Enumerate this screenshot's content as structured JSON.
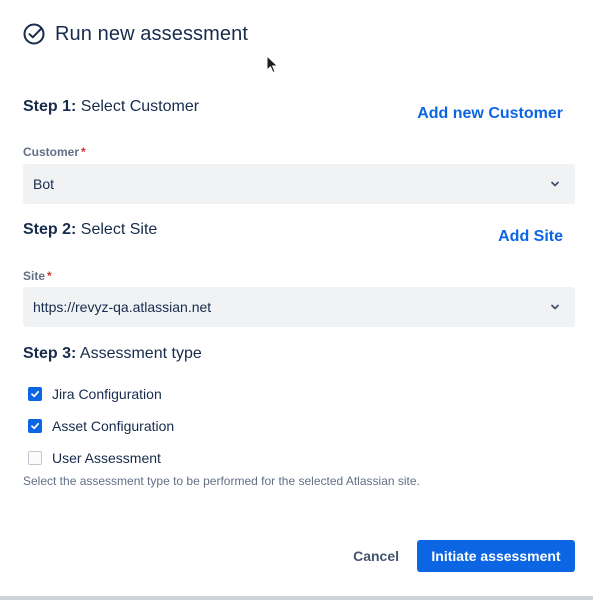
{
  "dialog": {
    "title": "Run new assessment",
    "title_icon": "check-circle-icon"
  },
  "step1": {
    "number": "Step 1:",
    "text": "Select Customer",
    "link": "Add new Customer",
    "field_label": "Customer",
    "required_mark": "*",
    "selected_value": "Bot",
    "dropdown_icon": "chevron-down-icon"
  },
  "step2": {
    "number": "Step 2:",
    "text": "Select Site",
    "link": "Add Site",
    "field_label": "Site",
    "required_mark": "*",
    "selected_value": "https://revyz-qa.atlassian.net",
    "dropdown_icon": "chevron-down-icon"
  },
  "step3": {
    "number": "Step 3:",
    "text": "Assessment type",
    "options": [
      {
        "label": "Jira Configuration",
        "checked": true
      },
      {
        "label": "Asset Configuration",
        "checked": true
      },
      {
        "label": "User Assessment",
        "checked": false
      }
    ],
    "help_text": "Select the assessment type to be performed for the selected Atlassian site."
  },
  "footer": {
    "cancel_label": "Cancel",
    "submit_label": "Initiate assessment"
  },
  "colors": {
    "primary": "#0c66e4",
    "text": "#172b4d",
    "subtle_text": "#626f86",
    "required": "#c9372c",
    "field_bg": "#f1f2f4"
  }
}
